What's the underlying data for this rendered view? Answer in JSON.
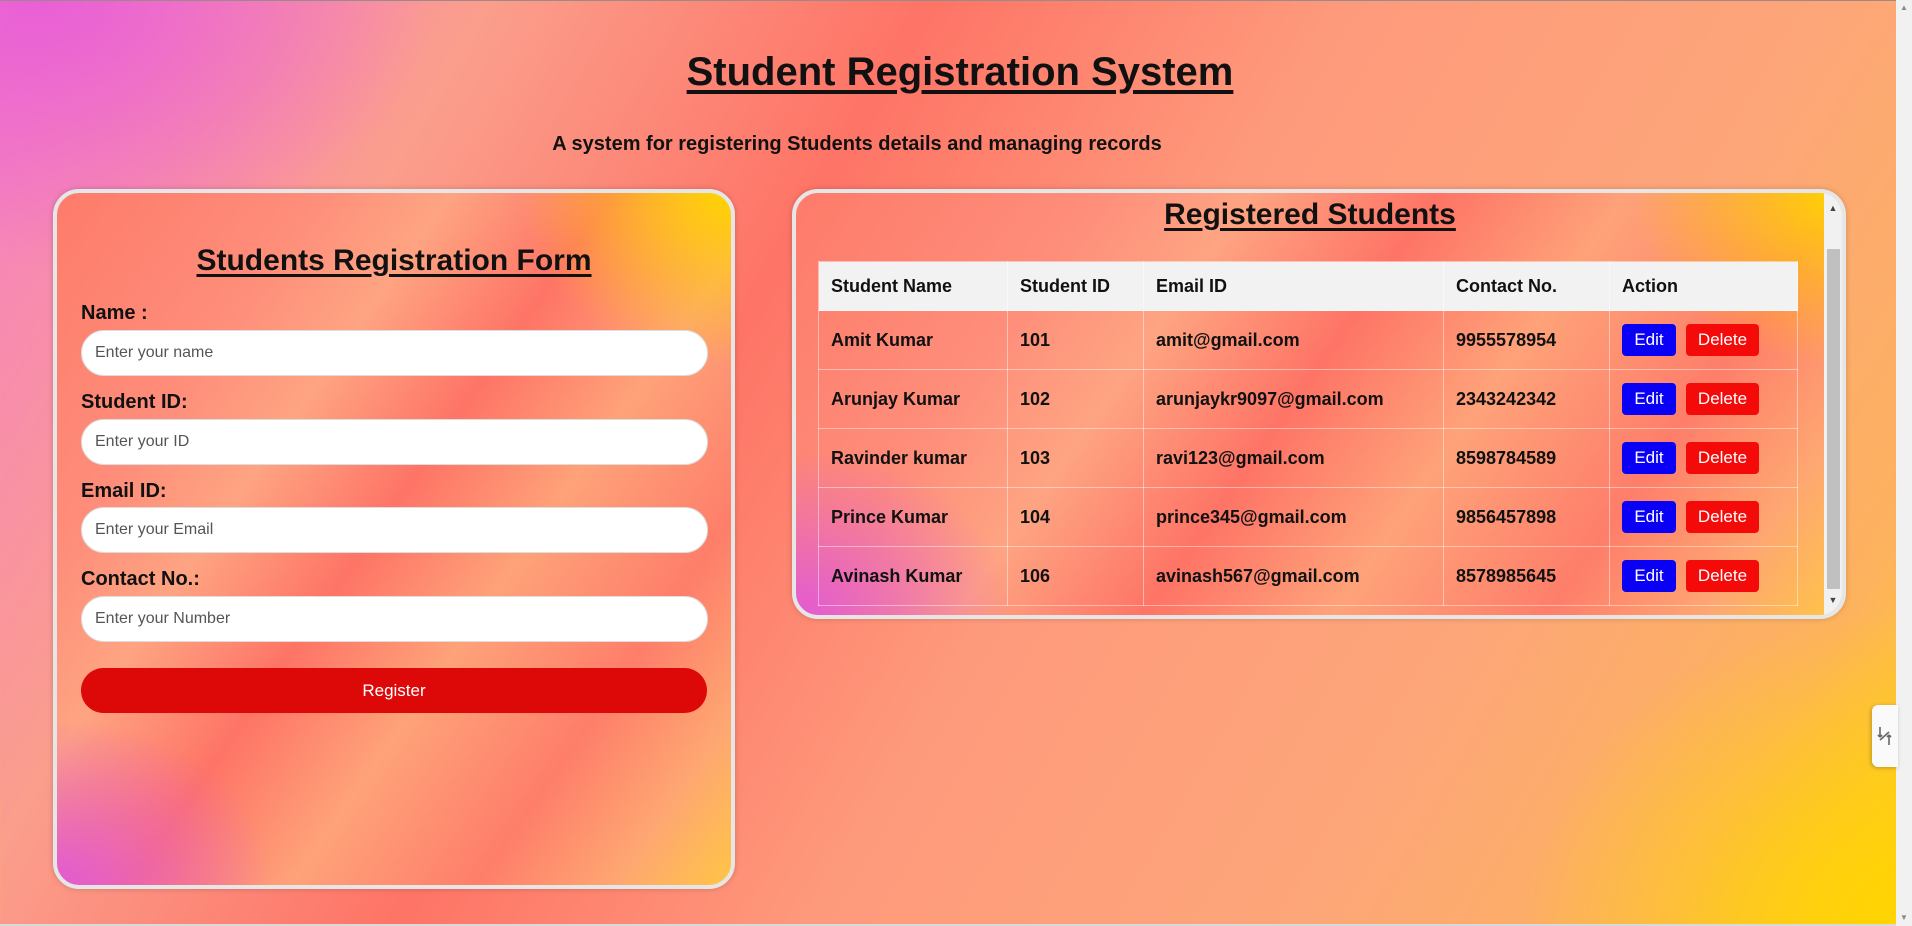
{
  "header": {
    "title": "Student Registration System",
    "subtitle": "A system for registering Students details and managing records"
  },
  "form": {
    "title": "Students Registration Form",
    "fields": [
      {
        "label": "Name :",
        "placeholder": "Enter your name"
      },
      {
        "label": "Student ID:",
        "placeholder": "Enter your ID"
      },
      {
        "label": "Email ID:",
        "placeholder": "Enter your Email"
      },
      {
        "label": "Contact No.:",
        "placeholder": "Enter your Number"
      }
    ],
    "submit_label": "Register"
  },
  "students": {
    "title": "Registered Students",
    "columns": [
      "Student Name",
      "Student ID",
      "Email ID",
      "Contact No.",
      "Action"
    ],
    "rows": [
      {
        "name": "Amit Kumar",
        "id": "101",
        "email": "amit@gmail.com",
        "contact": "9955578954"
      },
      {
        "name": "Arunjay Kumar",
        "id": "102",
        "email": "arunjaykr9097@gmail.com",
        "contact": "2343242342"
      },
      {
        "name": "Ravinder kumar",
        "id": "103",
        "email": "ravi123@gmail.com",
        "contact": "8598784589"
      },
      {
        "name": "Prince Kumar",
        "id": "104",
        "email": "prince345@gmail.com",
        "contact": "9856457898"
      },
      {
        "name": "Avinash Kumar",
        "id": "106",
        "email": "avinash567@gmail.com",
        "contact": "8578985645"
      }
    ],
    "edit_label": "Edit",
    "delete_label": "Delete"
  },
  "colors": {
    "register_button": "#dd0808",
    "edit_button": "#0a00f5",
    "delete_button": "#f50a0a",
    "page_gradient": [
      "#e95fd6",
      "#fe7466",
      "#fda679",
      "#ffd400"
    ]
  },
  "icons": {
    "side_widget": "collapse-arrows-icon"
  }
}
